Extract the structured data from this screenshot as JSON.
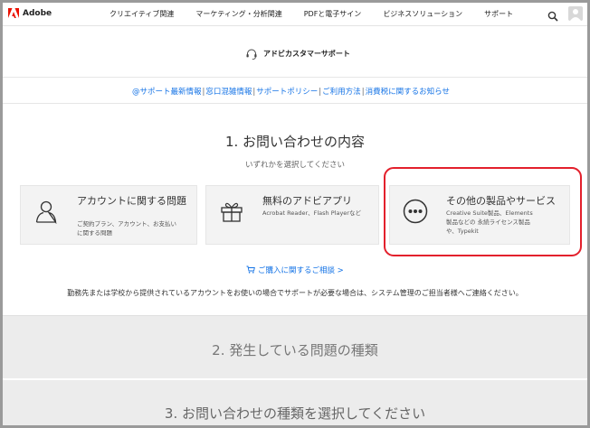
{
  "nav": {
    "brand": "Adobe",
    "links": [
      "クリエイティブ関連",
      "マーケティング・分析関連",
      "PDFと電子サイン",
      "ビジネスソリューション",
      "サポート"
    ]
  },
  "support": {
    "title": "アドビカスタマーサポート"
  },
  "linkbar": {
    "items": [
      "@サポート最新情報",
      "窓口混雑情報",
      "サポートポリシー",
      "ご利用方法",
      "消費税に関するお知らせ"
    ],
    "separator": "|"
  },
  "section1": {
    "title": "1. お問い合わせの内容",
    "subtitle": "いずれかを選択してください",
    "cards": [
      {
        "title": "アカウントに関する問題",
        "desc": "ご契約プラン、アカウント、お支払いに関する問題"
      },
      {
        "title": "無料のアドビアプリ",
        "desc": "Acrobat Reader、Flash Playerなど"
      },
      {
        "title": "その他の製品やサービス",
        "desc": "Creative Suite製品、Elements製品などの 永続ライセンス製品や、Typekit"
      }
    ],
    "purchase_link": "ご購入に関するご相談 >",
    "notice": "勤務先または学校から提供されているアカウントをお使いの場合でサポートが必要な場合は、システム管理のご担当者様へご連絡ください。"
  },
  "section2": {
    "title": "2. 発生している問題の種類"
  },
  "section3": {
    "title": "3. お問い合わせの種類を選択してください"
  },
  "colors": {
    "accent_link": "#1473e6",
    "highlight": "#e3202c",
    "adobe_red": "#eb1000"
  }
}
